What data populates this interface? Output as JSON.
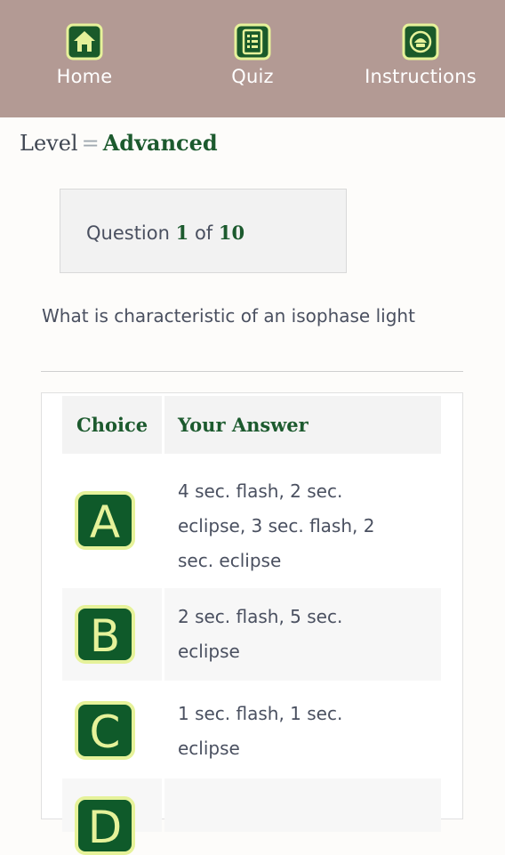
{
  "nav": {
    "items": [
      {
        "label": "Home",
        "icon": "home-icon"
      },
      {
        "label": "Quiz",
        "icon": "quiz-list-icon"
      },
      {
        "label": "Instructions",
        "icon": "instructions-icon"
      }
    ]
  },
  "level": {
    "label": "Level",
    "separator": "=",
    "value": "Advanced"
  },
  "question_box": {
    "prefix": "Question",
    "current": "1",
    "of": "of",
    "total": "10"
  },
  "question": {
    "text": "What is characteristic of an isophase light"
  },
  "table": {
    "headers": {
      "choice": "Choice",
      "answer": "Your Answer"
    },
    "rows": [
      {
        "letter": "A",
        "answer_lines": [
          "4 sec. flash, 2 sec.",
          "eclipse, 3 sec. flash, 2",
          "sec. eclipse"
        ]
      },
      {
        "letter": "B",
        "answer_lines": [
          "2 sec. flash, 5 sec.",
          "eclipse"
        ]
      },
      {
        "letter": "C",
        "answer_lines": [
          "1 sec. flash, 1 sec.",
          "eclipse"
        ]
      },
      {
        "letter": "D",
        "answer_lines": [
          "",
          ""
        ]
      }
    ]
  },
  "colors": {
    "nav_bg": "#b39a94",
    "accent_green": "#1c5a2e",
    "badge_border": "#e6f29a",
    "badge_fill": "#0f5a2a"
  }
}
